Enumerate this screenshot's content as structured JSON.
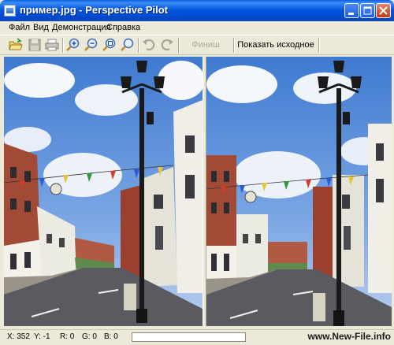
{
  "window": {
    "title": "пример.jpg - Perspective Pilot",
    "icon": "app-image-icon",
    "controls": {
      "minimize": "minimize-icon",
      "maximize": "maximize-icon",
      "close": "close-icon"
    }
  },
  "menu": {
    "items": [
      {
        "label": "Файл"
      },
      {
        "label": "Вид"
      },
      {
        "label": "Демонстрация"
      },
      {
        "label": "Справка"
      }
    ]
  },
  "toolbar": {
    "icons": [
      "open-icon",
      "save-icon",
      "print-icon",
      "zoom-in-icon",
      "zoom-out-icon",
      "zoom-fit-icon",
      "zoom-actual-icon",
      "undo-icon",
      "redo-icon"
    ],
    "finish_label": "Финиш",
    "show_original_label": "Показать исходное"
  },
  "status": {
    "x": "X: 352",
    "y": "Y: -1",
    "r": "R: 0",
    "g": "G: 0",
    "b": "B: 0",
    "watermark": "www.New-File.info"
  },
  "colors": {
    "title_bar": "#0058e6",
    "window_bg": "#ece9d8",
    "sky": "#5d8fd8",
    "disabled_text": "#aca899"
  }
}
